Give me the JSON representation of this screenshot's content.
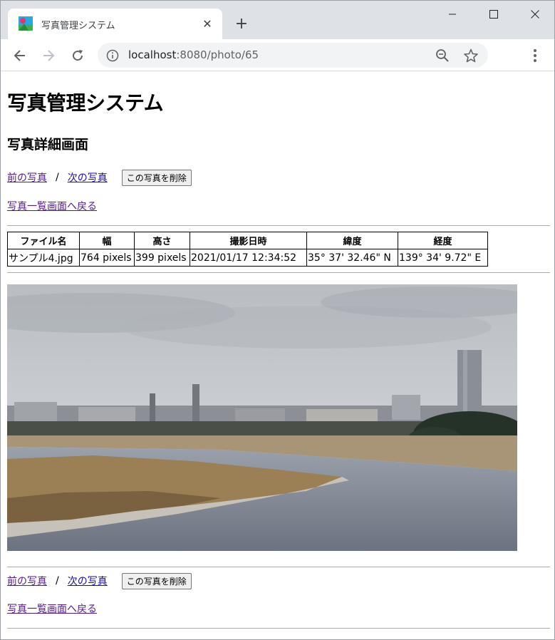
{
  "browser": {
    "tab_title": "写真管理システム",
    "tab_close": "✕",
    "new_tab": "+",
    "url_host": "localhost",
    "url_rest": ":8080/photo/65"
  },
  "page": {
    "title": "写真管理システム",
    "subtitle": "写真詳細画面",
    "prev_link": "前の写真",
    "separator": "/",
    "next_link": "次の写真",
    "delete_button": "この写真を削除",
    "back_link": "写真一覧画面へ戻る"
  },
  "table": {
    "headers": [
      "ファイル名",
      "幅",
      "高さ",
      "撮影日時",
      "緯度",
      "経度"
    ],
    "row": [
      "サンプル4.jpg",
      "764 pixels",
      "399 pixels",
      "2021/01/17 12:34:52",
      "35° 37' 32.46\" N",
      "139° 34' 9.72\" E"
    ]
  },
  "colors": {
    "link": "#1a0dab",
    "visited_link": "#551a8b",
    "tabstrip": "#dee1e6",
    "omnibox": "#f1f3f4"
  },
  "icons": [
    "app-favicon",
    "close-icon",
    "plus-icon",
    "minimize-icon",
    "maximize-icon",
    "window-close-icon",
    "back-arrow-icon",
    "forward-arrow-icon",
    "reload-icon",
    "info-icon",
    "zoom-out-icon",
    "star-icon",
    "kebab-menu-icon"
  ]
}
